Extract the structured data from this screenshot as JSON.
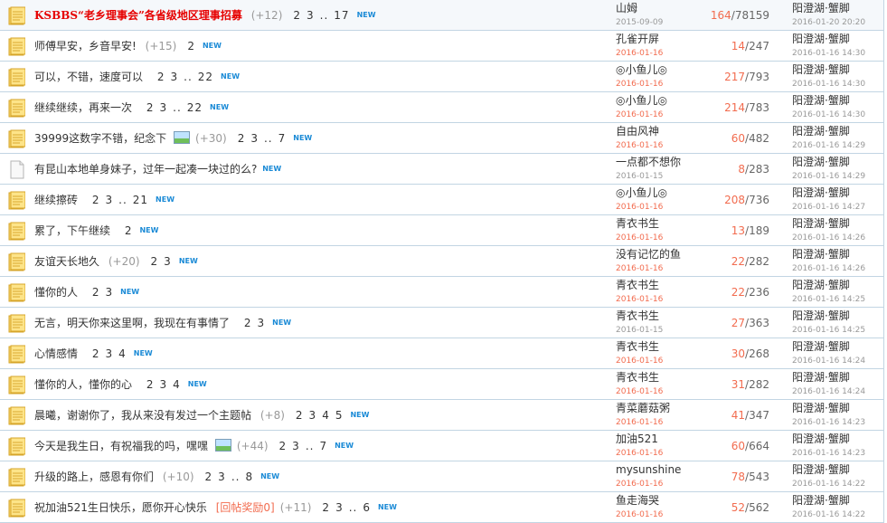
{
  "new_label": "NEW",
  "threads": [
    {
      "title": "KSBBS“老乡理事会”各省级地区理事招募",
      "hot": true,
      "icon": "folder",
      "count": "(+12)",
      "pages": [
        "2",
        "3",
        "..",
        "17"
      ],
      "author": "山姆",
      "date": "2015-09-09",
      "date_old": true,
      "replies": "164",
      "views": "78159",
      "last_author": "阳澄湖·蟹脚",
      "last_time": "2016-01-20 20:20",
      "sticky": true
    },
    {
      "title": "师傅早安，乡音早安!",
      "icon": "folder",
      "count": "(+15)",
      "pages": [
        "2"
      ],
      "author": "孔雀开屏",
      "date": "2016-01-16",
      "replies": "14",
      "views": "247",
      "last_author": "阳澄湖·蟹脚",
      "last_time": "2016-01-16 14:30"
    },
    {
      "title": "可以，不错，速度可以",
      "icon": "folder",
      "pages": [
        "2",
        "3",
        "..",
        "22"
      ],
      "author": "◎小鱼儿◎",
      "date": "2016-01-16",
      "replies": "217",
      "views": "793",
      "last_author": "阳澄湖·蟹脚",
      "last_time": "2016-01-16 14:30"
    },
    {
      "title": "继续继续，再来一次",
      "icon": "folder",
      "pages": [
        "2",
        "3",
        "..",
        "22"
      ],
      "author": "◎小鱼儿◎",
      "date": "2016-01-16",
      "replies": "214",
      "views": "783",
      "last_author": "阳澄湖·蟹脚",
      "last_time": "2016-01-16 14:30"
    },
    {
      "title": "39999这数字不错，纪念下",
      "icon": "folder",
      "image": true,
      "count": "(+30)",
      "pages": [
        "2",
        "3",
        "..",
        "7"
      ],
      "author": "自由风神",
      "date": "2016-01-16",
      "replies": "60",
      "views": "482",
      "last_author": "阳澄湖·蟹脚",
      "last_time": "2016-01-16 14:29"
    },
    {
      "title": "有昆山本地单身妹子，过年一起凑一块过的么?",
      "icon": "doc",
      "pages": [],
      "author": "一点都不想你",
      "date": "2016-01-15",
      "date_old": true,
      "replies": "8",
      "views": "283",
      "last_author": "阳澄湖·蟹脚",
      "last_time": "2016-01-16 14:29"
    },
    {
      "title": "继续擦砖",
      "icon": "folder",
      "pages": [
        "2",
        "3",
        "..",
        "21"
      ],
      "author": "◎小鱼儿◎",
      "date": "2016-01-16",
      "replies": "208",
      "views": "736",
      "last_author": "阳澄湖·蟹脚",
      "last_time": "2016-01-16 14:27"
    },
    {
      "title": "累了，下午继续",
      "icon": "folder",
      "pages": [
        "2"
      ],
      "author": "青衣书生",
      "date": "2016-01-16",
      "replies": "13",
      "views": "189",
      "last_author": "阳澄湖·蟹脚",
      "last_time": "2016-01-16 14:26"
    },
    {
      "title": "友谊天长地久",
      "icon": "folder",
      "count": "(+20)",
      "pages": [
        "2",
        "3"
      ],
      "author": "没有记忆的鱼",
      "date": "2016-01-16",
      "replies": "22",
      "views": "282",
      "last_author": "阳澄湖·蟹脚",
      "last_time": "2016-01-16 14:26"
    },
    {
      "title": "懂你的人",
      "icon": "folder",
      "pages": [
        "2",
        "3"
      ],
      "author": "青衣书生",
      "date": "2016-01-16",
      "replies": "22",
      "views": "236",
      "last_author": "阳澄湖·蟹脚",
      "last_time": "2016-01-16 14:25"
    },
    {
      "title": "无言，明天你来这里啊，我现在有事情了",
      "icon": "folder",
      "pages": [
        "2",
        "3"
      ],
      "author": "青衣书生",
      "date": "2016-01-15",
      "date_old": true,
      "replies": "27",
      "views": "363",
      "last_author": "阳澄湖·蟹脚",
      "last_time": "2016-01-16 14:25"
    },
    {
      "title": "心情感情",
      "icon": "folder",
      "pages": [
        "2",
        "3",
        "4"
      ],
      "author": "青衣书生",
      "date": "2016-01-16",
      "replies": "30",
      "views": "268",
      "last_author": "阳澄湖·蟹脚",
      "last_time": "2016-01-16 14:24"
    },
    {
      "title": "懂你的人，懂你的心",
      "icon": "folder",
      "pages": [
        "2",
        "3",
        "4"
      ],
      "author": "青衣书生",
      "date": "2016-01-16",
      "replies": "31",
      "views": "282",
      "last_author": "阳澄湖·蟹脚",
      "last_time": "2016-01-16 14:24"
    },
    {
      "title": "晨曦，谢谢你了，我从来没有发过一个主题帖",
      "icon": "folder",
      "count": "(+8)",
      "pages": [
        "2",
        "3",
        "4",
        "5"
      ],
      "author": "青菜蘑菇粥",
      "date": "2016-01-16",
      "replies": "41",
      "views": "347",
      "last_author": "阳澄湖·蟹脚",
      "last_time": "2016-01-16 14:23"
    },
    {
      "title": "今天是我生日，有祝福我的吗，嘿嘿",
      "icon": "folder",
      "image": true,
      "count": "(+44)",
      "pages": [
        "2",
        "3",
        "..",
        "7"
      ],
      "author": "加油521",
      "date": "2016-01-16",
      "replies": "60",
      "views": "664",
      "last_author": "阳澄湖·蟹脚",
      "last_time": "2016-01-16 14:23"
    },
    {
      "title": "升级的路上，感恩有你们",
      "icon": "folder",
      "count": "(+10)",
      "pages": [
        "2",
        "3",
        "..",
        "8"
      ],
      "author": "mysunshine",
      "date": "2016-01-16",
      "replies": "78",
      "views": "543",
      "last_author": "阳澄湖·蟹脚",
      "last_time": "2016-01-16 14:22"
    },
    {
      "title": "祝加油521生日快乐，愿你开心快乐",
      "icon": "folder",
      "reward": "[回帖奖励0]",
      "count": "(+11)",
      "pages": [
        "2",
        "3",
        "..",
        "6"
      ],
      "author": "鱼走海哭",
      "date": "2016-01-16",
      "replies": "52",
      "views": "562",
      "last_author": "阳澄湖·蟹脚",
      "last_time": "2016-01-16 14:22"
    }
  ]
}
